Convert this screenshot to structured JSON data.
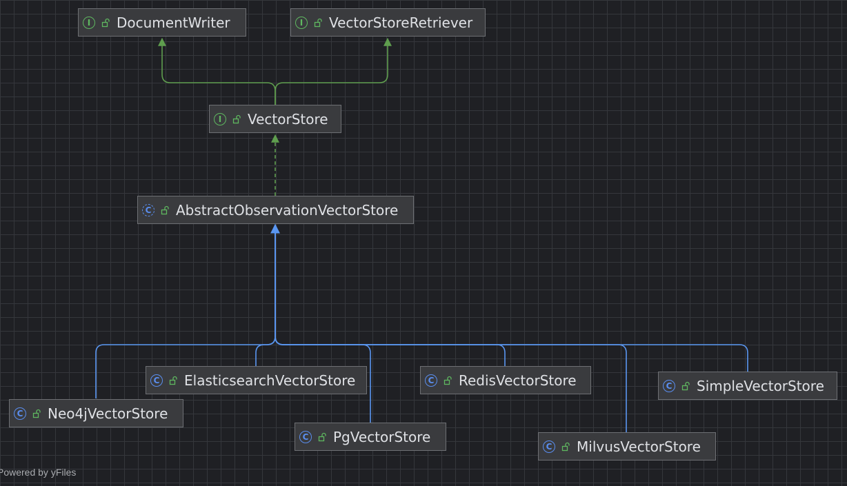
{
  "diagram": {
    "colors": {
      "implements": "#5f9e4e",
      "extends": "#5a97f2"
    },
    "nodes": [
      {
        "id": "document-writer",
        "label": "DocumentWriter",
        "kind": "interface",
        "kind_glyph": "I",
        "icon": "interface-icon"
      },
      {
        "id": "vector-store-retriever",
        "label": "VectorStoreRetriever",
        "kind": "interface",
        "kind_glyph": "I",
        "icon": "interface-icon"
      },
      {
        "id": "vector-store",
        "label": "VectorStore",
        "kind": "interface",
        "kind_glyph": "I",
        "icon": "interface-icon"
      },
      {
        "id": "abstract-observation-vector-store",
        "label": "AbstractObservationVectorStore",
        "kind": "abstract-class",
        "kind_glyph": "C",
        "icon": "abstract-class-icon"
      },
      {
        "id": "elasticsearch-vector-store",
        "label": "ElasticsearchVectorStore",
        "kind": "class",
        "kind_glyph": "C",
        "icon": "class-icon"
      },
      {
        "id": "redis-vector-store",
        "label": "RedisVectorStore",
        "kind": "class",
        "kind_glyph": "C",
        "icon": "class-icon"
      },
      {
        "id": "simple-vector-store",
        "label": "SimpleVectorStore",
        "kind": "class",
        "kind_glyph": "C",
        "icon": "class-icon"
      },
      {
        "id": "neo4j-vector-store",
        "label": "Neo4jVectorStore",
        "kind": "class",
        "kind_glyph": "C",
        "icon": "class-icon"
      },
      {
        "id": "pg-vector-store",
        "label": "PgVectorStore",
        "kind": "class",
        "kind_glyph": "C",
        "icon": "class-icon"
      },
      {
        "id": "milvus-vector-store",
        "label": "MilvusVectorStore",
        "kind": "class",
        "kind_glyph": "C",
        "icon": "class-icon"
      }
    ],
    "edges": [
      {
        "from": "vector-store",
        "to": "document-writer",
        "relation": "extends-interface"
      },
      {
        "from": "vector-store",
        "to": "vector-store-retriever",
        "relation": "extends-interface"
      },
      {
        "from": "abstract-observation-vector-store",
        "to": "vector-store",
        "relation": "implements"
      },
      {
        "from": "elasticsearch-vector-store",
        "to": "abstract-observation-vector-store",
        "relation": "extends"
      },
      {
        "from": "redis-vector-store",
        "to": "abstract-observation-vector-store",
        "relation": "extends"
      },
      {
        "from": "simple-vector-store",
        "to": "abstract-observation-vector-store",
        "relation": "extends"
      },
      {
        "from": "neo4j-vector-store",
        "to": "abstract-observation-vector-store",
        "relation": "extends"
      },
      {
        "from": "pg-vector-store",
        "to": "abstract-observation-vector-store",
        "relation": "extends"
      },
      {
        "from": "milvus-vector-store",
        "to": "abstract-observation-vector-store",
        "relation": "extends"
      }
    ]
  },
  "footer": {
    "text": "Powered by yFiles"
  }
}
